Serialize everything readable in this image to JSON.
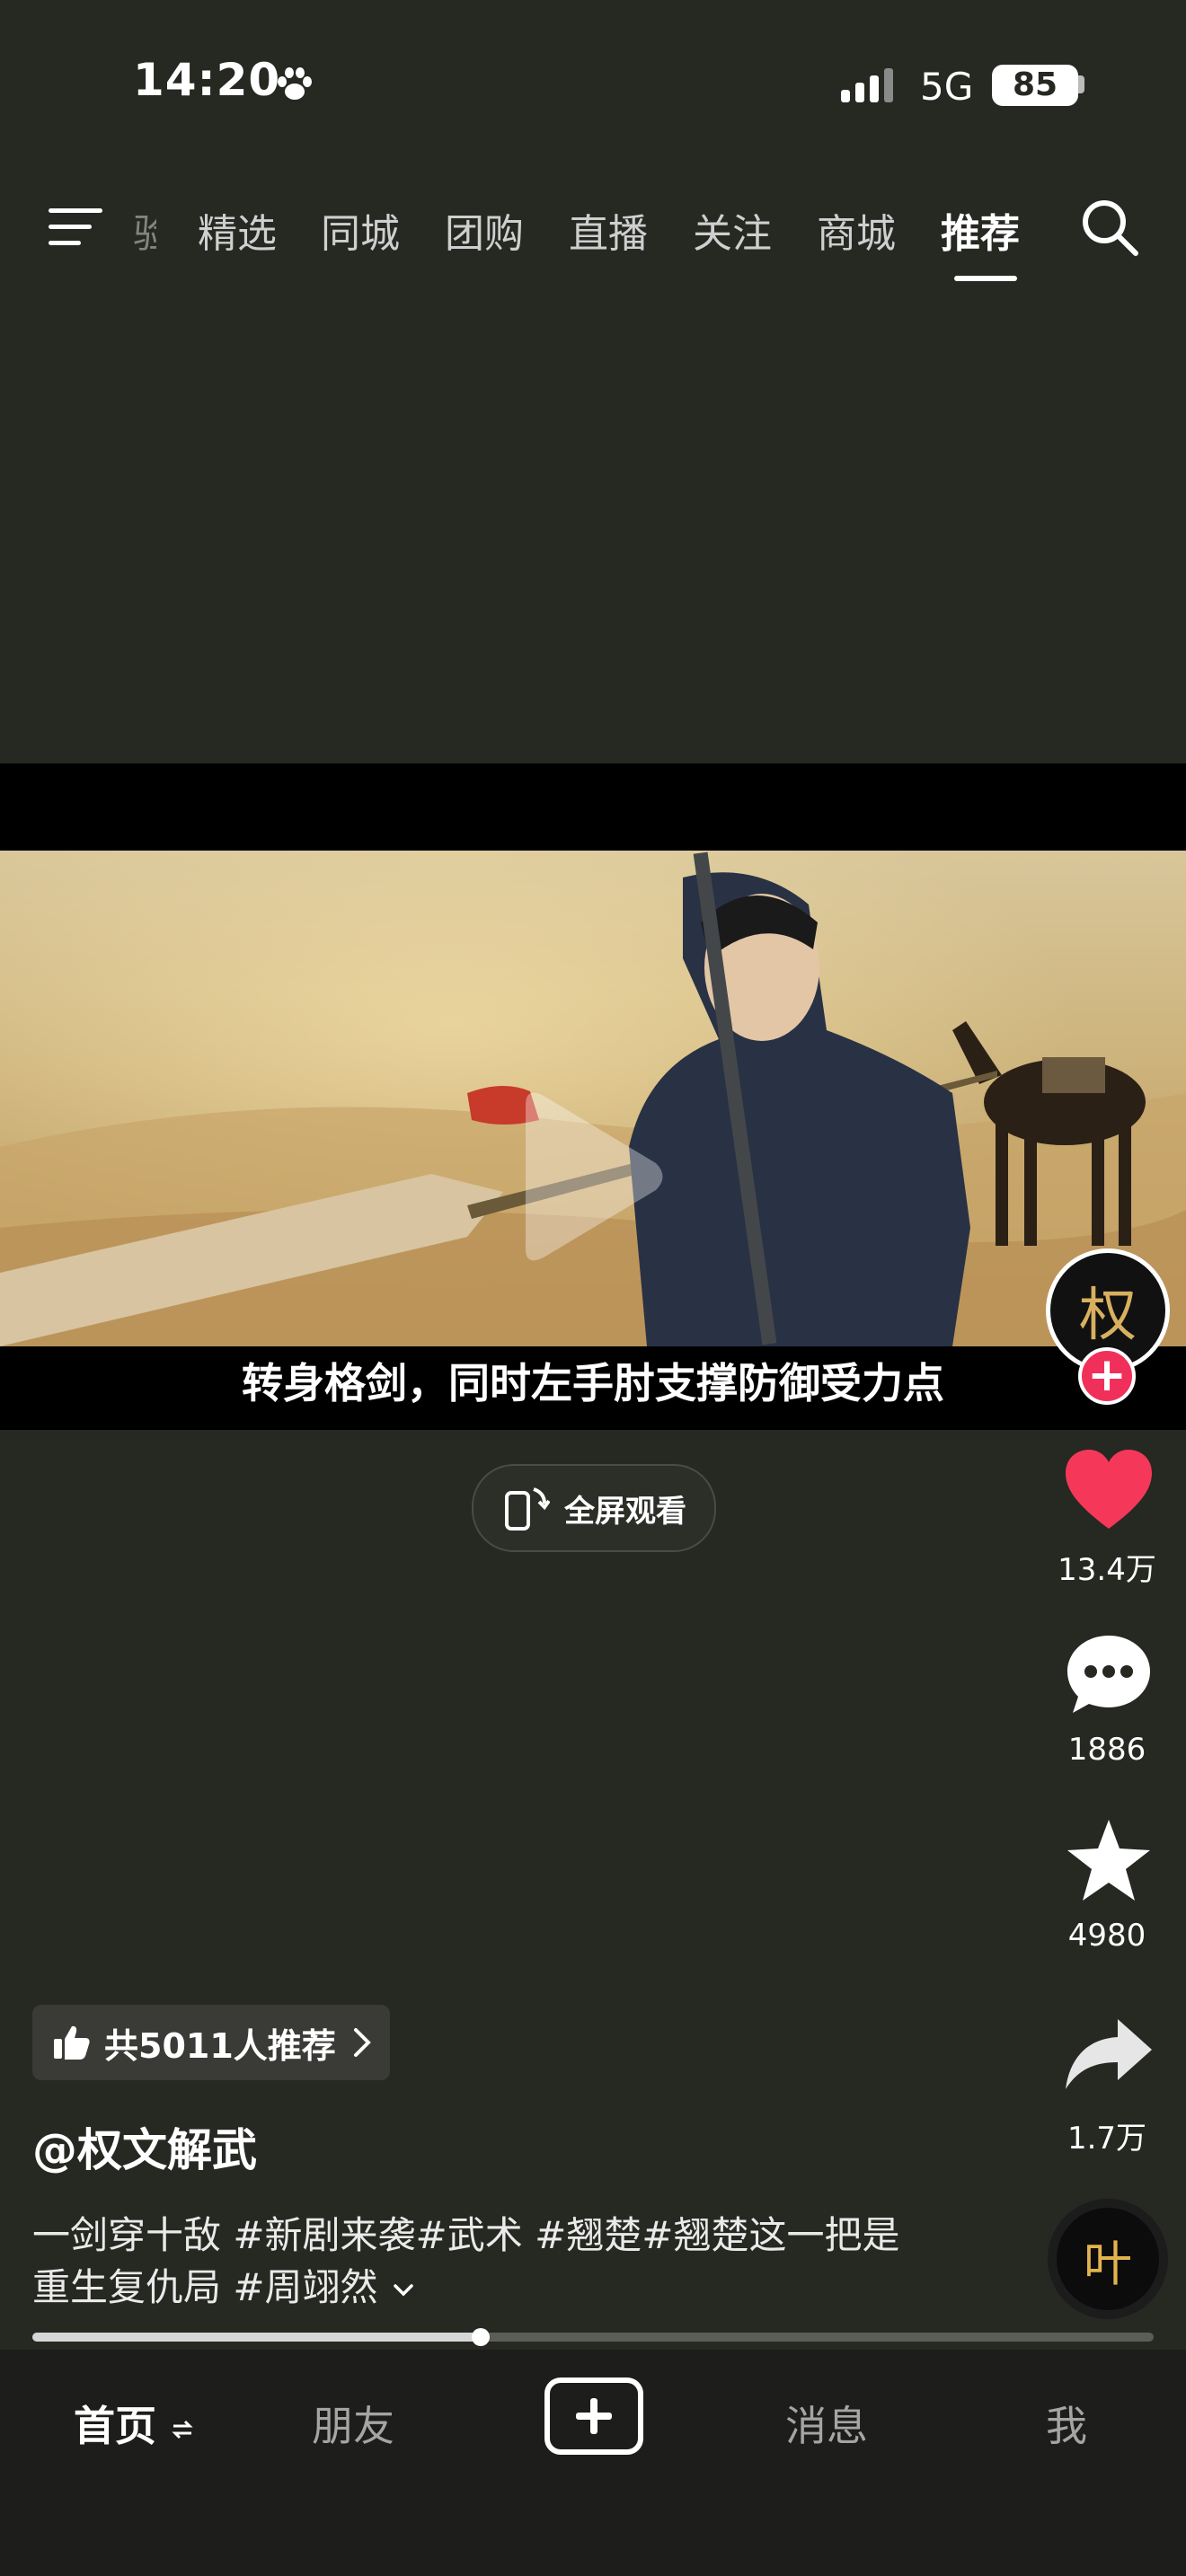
{
  "status_bar": {
    "time": "14:20",
    "network": "5G",
    "battery": "85"
  },
  "top_nav": {
    "tabs": [
      {
        "label": "验",
        "active": false
      },
      {
        "label": "精选",
        "active": false
      },
      {
        "label": "同城",
        "active": false
      },
      {
        "label": "团购",
        "active": false
      },
      {
        "label": "直播",
        "active": false
      },
      {
        "label": "关注",
        "active": false
      },
      {
        "label": "商城",
        "active": false
      },
      {
        "label": "推荐",
        "active": true
      }
    ]
  },
  "video": {
    "subtitle": "转身格剑，同时左手肘支撑防御受力点",
    "fullscreen_label": "全屏观看"
  },
  "rail": {
    "avatar_text": "权",
    "like_count": "13.4万",
    "comment_count": "1886",
    "favorite_count": "4980",
    "share_count": "1.7万",
    "music_text": "叶",
    "like_color": "#f5385a"
  },
  "info": {
    "recommend_label": "共5011人推荐",
    "author": "@权文解武",
    "description_line1": "一剑穿十敌 #新剧来袭#武术 #翘楚#翘楚这一把是",
    "description_line2": "重生复仇局 #周翊然"
  },
  "progress": {
    "fraction": 0.4
  },
  "bottom_nav": {
    "home": "首页",
    "friends": "朋友",
    "messages": "消息",
    "me": "我"
  }
}
